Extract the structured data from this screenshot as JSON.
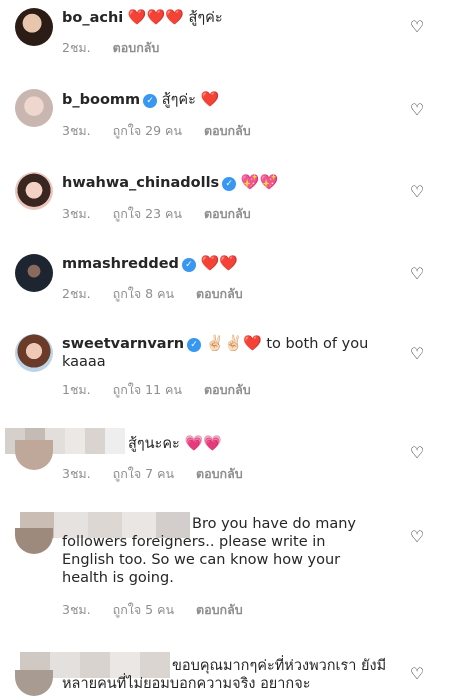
{
  "comments": [
    {
      "username": "bo_achi",
      "verified": false,
      "text": "❤️❤️❤️ สู้ๆค่ะ",
      "time": "2ชม.",
      "likes": "",
      "reply": "ตอบกลับ"
    },
    {
      "username": "b_boomm",
      "verified": true,
      "text": "สู้ๆค่ะ ❤️",
      "time": "3ชม.",
      "likes": "ถูกใจ 29 คน",
      "reply": "ตอบกลับ"
    },
    {
      "username": "hwahwa_chinadolls",
      "verified": true,
      "text": "💖💖",
      "time": "3ชม.",
      "likes": "ถูกใจ 23 คน",
      "reply": "ตอบกลับ"
    },
    {
      "username": "mmashredded",
      "verified": true,
      "text": "❤️❤️",
      "time": "2ชม.",
      "likes": "ถูกใจ 8 คน",
      "reply": "ตอบกลับ"
    },
    {
      "username": "sweetvarnvarn",
      "verified": true,
      "text": "✌🏻✌🏻❤️ to both of you kaaaa",
      "time": "1ชม.",
      "likes": "ถูกใจ 11 คน",
      "reply": "ตอบกลับ"
    },
    {
      "username": "",
      "verified": false,
      "text": "สู้ๆนะคะ 💗💗",
      "time": "3ชม.",
      "likes": "ถูกใจ 7 คน",
      "reply": "ตอบกลับ"
    },
    {
      "username": "",
      "verified": false,
      "text": "Bro you have do many followers foreigners.. please write in English too. So we can know how your health is going.",
      "time": "3ชม.",
      "likes": "ถูกใจ 5 คน",
      "reply": "ตอบกลับ"
    },
    {
      "username": "",
      "verified": false,
      "text": "ขอบคุณมากๆค่ะที่ห่วงพวกเรา ยังมีหลายคนที่ไม่ยอมบอกความจริง อยากจะ",
      "time": "",
      "likes": "",
      "reply": ""
    }
  ],
  "icons": {
    "like": "heart-outline-icon",
    "verified": "verified-badge-icon"
  },
  "colors": {
    "verified": "#3897f0",
    "heart": "#e0245e",
    "meta": "#8e8e8e"
  }
}
